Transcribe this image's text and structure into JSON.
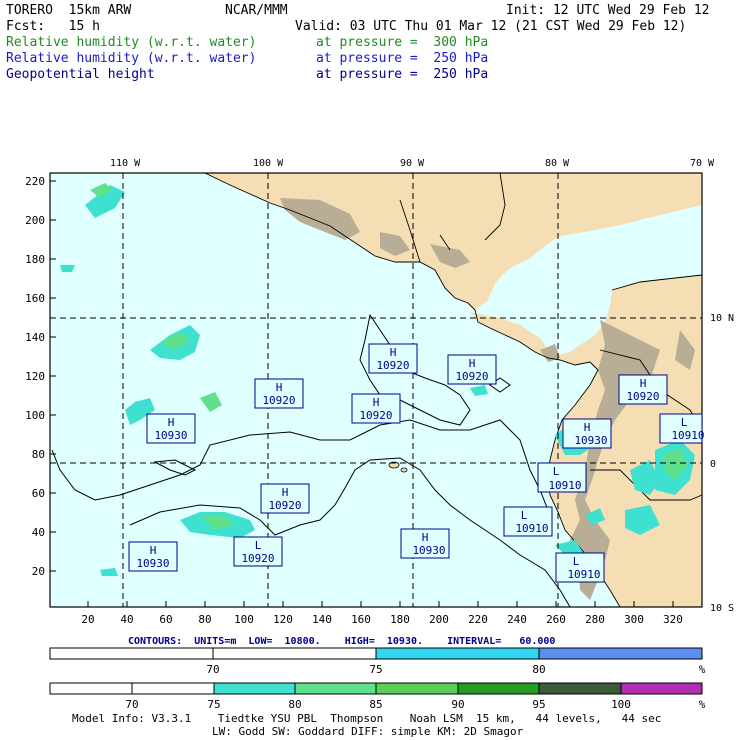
{
  "header": {
    "model": "TORERO  15km ARW",
    "org": "NCAR/MMM",
    "init": "Init: 12 UTC Wed 29 Feb 12",
    "fcst": "Fcst:   15 h",
    "valid": "Valid: 03 UTC Thu 01 Mar 12 (21 CST Wed 29 Feb 12)",
    "fields": [
      {
        "name": "Relative humidity (w.r.t. water)",
        "level": "at pressure =  300 hPa",
        "color": "#228b22"
      },
      {
        "name": "Relative humidity (w.r.t. water)",
        "level": "at pressure =  250 hPa",
        "color": "#1a1acd"
      },
      {
        "name": "Geopotential height",
        "level": "at pressure =  250 hPa",
        "color": "#00008b"
      }
    ]
  },
  "map": {
    "lon_labels": [
      "110 W",
      "100 W",
      "90 W",
      "80 W",
      "70 W"
    ],
    "lat_labels": [
      "10 N",
      "0",
      "10 S"
    ],
    "y_ticks": [
      "220",
      "200",
      "180",
      "160",
      "140",
      "120",
      "100",
      "80",
      "60",
      "40",
      "20"
    ],
    "x_ticks": [
      "20",
      "40",
      "60",
      "80",
      "100",
      "120",
      "140",
      "160",
      "180",
      "200",
      "220",
      "240",
      "260",
      "280",
      "300",
      "320"
    ],
    "centers": [
      {
        "type": "H",
        "value": "10920"
      },
      {
        "type": "H",
        "value": "10920"
      },
      {
        "type": "H",
        "value": "10920"
      },
      {
        "type": "H",
        "value": "10920"
      },
      {
        "type": "H",
        "value": "10930"
      },
      {
        "type": "H",
        "value": "10920"
      },
      {
        "type": "H",
        "value": "10930"
      },
      {
        "type": "H",
        "value": "10920"
      },
      {
        "type": "L",
        "value": "10910"
      },
      {
        "type": "H",
        "value": "10930"
      },
      {
        "type": "L",
        "value": "10920"
      },
      {
        "type": "H",
        "value": "10930"
      },
      {
        "type": "L",
        "value": "10910"
      },
      {
        "type": "L",
        "value": "10910"
      },
      {
        "type": "L",
        "value": "10910"
      }
    ],
    "colors": {
      "ocean": "#e0ffff",
      "land": "#f5deb3",
      "terrain_dark": "#a89f8c"
    }
  },
  "contours_note": {
    "text": "CONTOURS:  UNITS=m  LOW=  10800.    HIGH=  10930.    INTERVAL=   60.000"
  },
  "colorbar_300": {
    "labels": [
      "70",
      "75",
      "80"
    ],
    "unit": "%",
    "colors": [
      "#ffffff",
      "#ffffff",
      "#33d6f2",
      "#5c8ef0"
    ]
  },
  "colorbar_250": {
    "labels": [
      "70",
      "75",
      "80",
      "85",
      "90",
      "95",
      "100"
    ],
    "unit": "%",
    "colors": [
      "#ffffff",
      "#ffffff",
      "#3ee0d0",
      "#5ee08c",
      "#58d058",
      "#259c25",
      "#3a5a3a",
      "#b22db2"
    ]
  },
  "footer": {
    "line1": "Model Info: V3.3.1    Tiedtke YSU PBL  Thompson    Noah LSM  15 km,   44 levels,   44 sec",
    "line2": "LW: Godd SW: Goddard DIFF: simple KM: 2D Smagor"
  }
}
